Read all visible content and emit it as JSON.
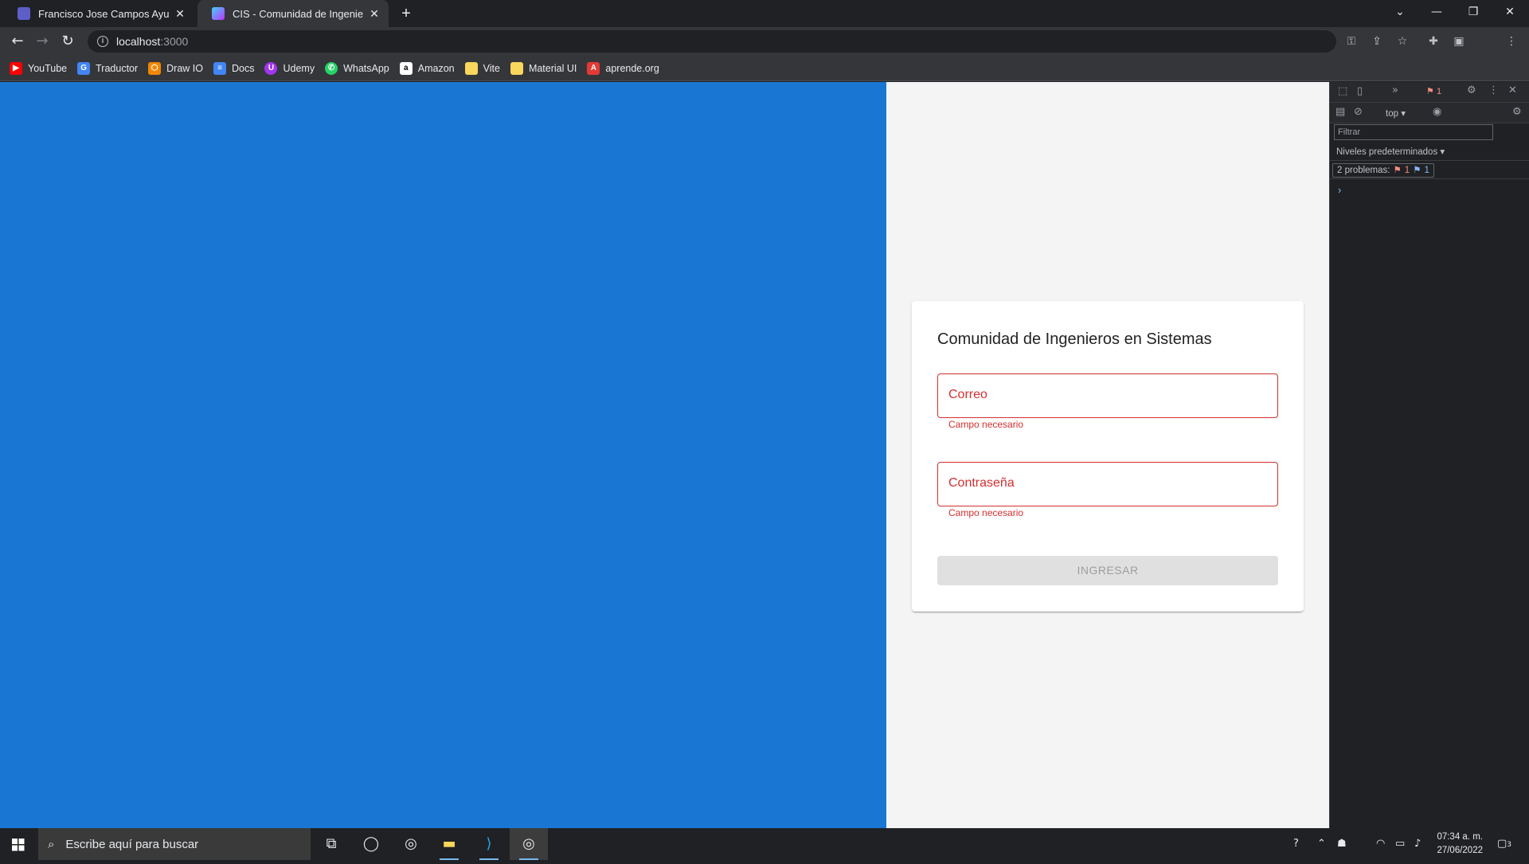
{
  "browser": {
    "tabs": [
      {
        "title": "Francisco Jose Campos Ayuso | M",
        "active": false
      },
      {
        "title": "CIS - Comunidad de Ingenieros e",
        "active": true
      }
    ],
    "new_tab_label": "+",
    "url_host": "localhost",
    "url_port": ":3000",
    "bookmarks": [
      {
        "label": "YouTube",
        "icon": "youtube-icon",
        "color": "#ff0000"
      },
      {
        "label": "Traductor",
        "icon": "translate-icon",
        "color": "#4285f4"
      },
      {
        "label": "Draw IO",
        "icon": "drawio-icon",
        "color": "#f08705"
      },
      {
        "label": "Docs",
        "icon": "docs-icon",
        "color": "#4285f4"
      },
      {
        "label": "Udemy",
        "icon": "udemy-icon",
        "color": "#a435f0"
      },
      {
        "label": "WhatsApp",
        "icon": "whatsapp-icon",
        "color": "#25d366"
      },
      {
        "label": "Amazon",
        "icon": "amazon-icon",
        "color": "#ffffff"
      },
      {
        "label": "Vite",
        "icon": "folder-icon",
        "color": "#f9d65c"
      },
      {
        "label": "Material UI",
        "icon": "folder-icon",
        "color": "#f9d65c"
      },
      {
        "label": "aprende.org",
        "icon": "aprende-icon",
        "color": "#e53935"
      }
    ]
  },
  "page": {
    "card_title": "Comunidad de Ingenieros en Sistemas",
    "email_label": "Correo",
    "email_helper": "Campo necesario",
    "password_label": "Contraseña",
    "password_helper": "Campo necesario",
    "submit_label": "INGRESAR",
    "colors": {
      "panel": "#1976d2",
      "error": "#d32f2f",
      "background": "#f4f4f4"
    }
  },
  "devtools": {
    "error_count": "1",
    "context": "top",
    "filter_placeholder": "Filtrar",
    "levels_label": "Niveles predeterminados",
    "problems_label": "2 problemas:",
    "problems_errors": "1",
    "problems_info": "1",
    "prompt": "›"
  },
  "taskbar": {
    "search_placeholder": "Escribe aquí para buscar",
    "time": "07:34 a. m.",
    "date": "27/06/2022",
    "notification_count": "3"
  }
}
